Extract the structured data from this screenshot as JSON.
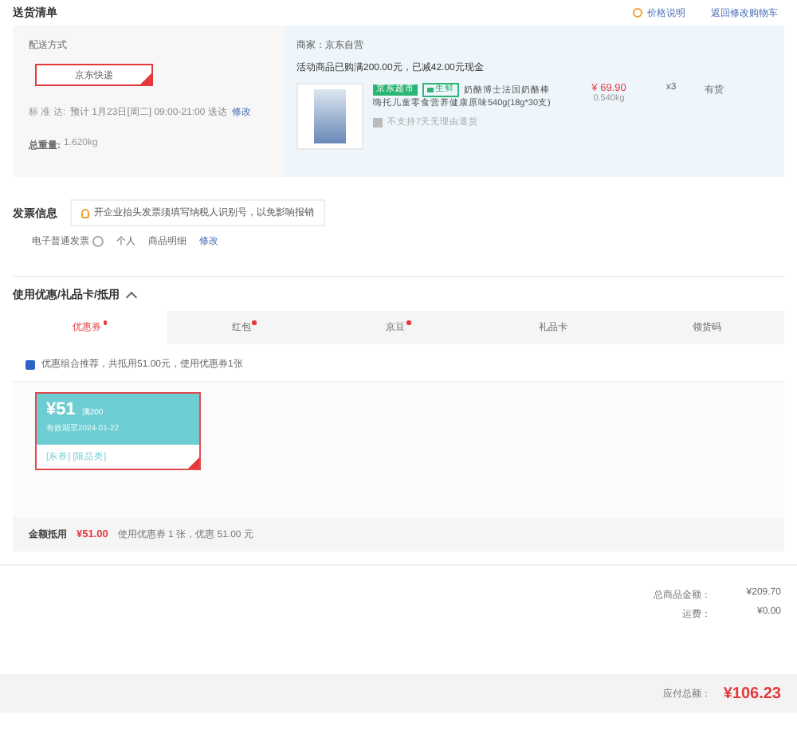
{
  "header": {
    "title": "送货清单",
    "links": [
      {
        "label": "价格说明",
        "kind": "info"
      },
      {
        "label": "返回修改购物车",
        "kind": "plain"
      }
    ]
  },
  "delivery": {
    "label": "配送方式",
    "method": {
      "label": "京东快递",
      "selected": true
    },
    "eta_label": "标 准 达:",
    "eta": "预计 1月23日[周二] 09:00-21:00 送达",
    "edit": "修改",
    "weight_label": "总重量:",
    "weight": "1.620kg"
  },
  "shop": {
    "seller": "商家：京东自营",
    "promo": "活动商品已购满200.00元，已减42.00元现金",
    "product": {
      "tags": [
        {
          "label": "京东超市",
          "kind": "solid"
        },
        {
          "label": "生鲜",
          "kind": "outline"
        }
      ],
      "title_lines": [
        "奶酪博士法国奶酪棒",
        "嗨托儿童零食营养健康原味540g(18g*30支)"
      ],
      "price": "¥ 69.90",
      "weight": "0.540kg",
      "qty": "x3",
      "stock": "有货",
      "note": "不支持7天无理由退货"
    }
  },
  "invoice": {
    "title": "发票信息",
    "tip": "开企业抬头发票须填写纳税人识别号，以免影响报销",
    "type": "电子普通发票",
    "items": [
      "个人",
      "商品明细"
    ],
    "edit": "修改"
  },
  "discounts": {
    "title": "使用优惠/礼品卡/抵用",
    "expanded": true,
    "tabs": [
      {
        "label": "优惠券",
        "selected": true,
        "dot": true
      },
      {
        "label": "红包",
        "selected": false,
        "dot": true
      },
      {
        "label": "京豆",
        "selected": false,
        "dot": true
      },
      {
        "label": "礼品卡",
        "selected": false,
        "dot": false
      },
      {
        "label": "领货码",
        "selected": false,
        "dot": false
      }
    ],
    "auto": {
      "label": "优惠组合推荐，共抵用51.00元，使用优惠券1张",
      "checked": true
    },
    "coupons": [
      {
        "amount": "¥51",
        "condition": "满200",
        "expiry": "有效期至2024-01-22",
        "scope": "[东券] [限品类]",
        "selected": true
      }
    ],
    "footer_label": "金额抵用",
    "footer_amount": "¥51.00",
    "footer_note": "使用优惠券 1 张，优惠 51.00 元"
  },
  "summary": {
    "rows": [
      {
        "label": "总商品金额：",
        "value": "¥209.70"
      },
      {
        "label": "运费：",
        "value": "¥0.00"
      }
    ],
    "total_label": "应付总额：",
    "total": "¥106.23"
  }
}
